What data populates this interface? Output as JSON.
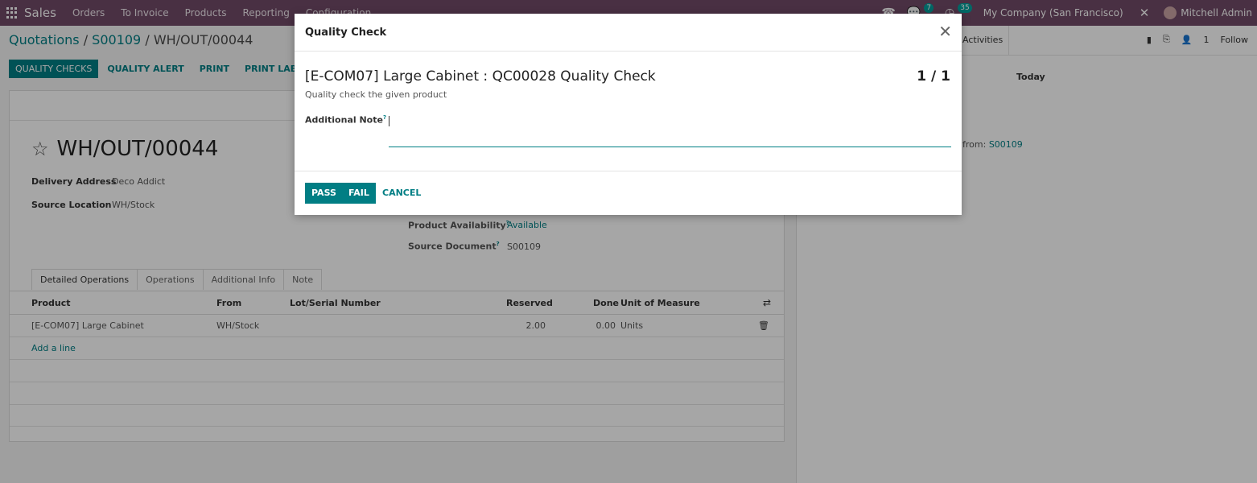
{
  "navbar": {
    "brand": "Sales",
    "menu": [
      "Orders",
      "To Invoice",
      "Products",
      "Reporting",
      "Configuration"
    ],
    "messages_count": "7",
    "activities_count": "35",
    "company": "My Company (San Francisco)",
    "user": "Mitchell Admin"
  },
  "breadcrumb": {
    "root": "Quotations",
    "parent": "S00109",
    "current": "WH/OUT/00044"
  },
  "buttons": {
    "quality_checks": "QUALITY CHECKS",
    "quality_alert": "QUALITY ALERT",
    "print": "PRINT",
    "print_labels": "PRINT LABELS"
  },
  "form": {
    "title": "WH/OUT/00044",
    "delivery_address_label": "Delivery Address",
    "delivery_address": "Deco Addict",
    "source_location_label": "Source Location",
    "source_location": "WH/Stock",
    "product_availability_label": "Product Availability",
    "product_availability": "Available",
    "source_document_label": "Source Document",
    "source_document": "S00109",
    "help_mark": "?"
  },
  "tabs": [
    "Detailed Operations",
    "Operations",
    "Additional Info",
    "Note"
  ],
  "table": {
    "headers": {
      "product": "Product",
      "from": "From",
      "lot": "Lot/Serial Number",
      "reserved": "Reserved",
      "done": "Done",
      "uom": "Unit of Measure"
    },
    "rows": [
      {
        "product": "[E-COM07] Large Cabinet",
        "from": "WH/Stock",
        "lot": "",
        "reserved": "2.00",
        "done": "0.00",
        "uom": "Units"
      }
    ],
    "add_line": "Add a line"
  },
  "chatter": {
    "activities": "Activities",
    "followers_count": "1",
    "follow": "Follow",
    "today": "Today",
    "message_prefix": "from:",
    "message_link": "S00109"
  },
  "modal": {
    "title": "Quality Check",
    "check_title": "[E-COM07] Large Cabinet : QC00028  Quality Check",
    "counter": "1 / 1",
    "subtitle": "Quality check the given product",
    "note_label": "Additional Note",
    "note_value": "",
    "pass": "PASS",
    "fail": "FAIL",
    "cancel": "CANCEL"
  }
}
